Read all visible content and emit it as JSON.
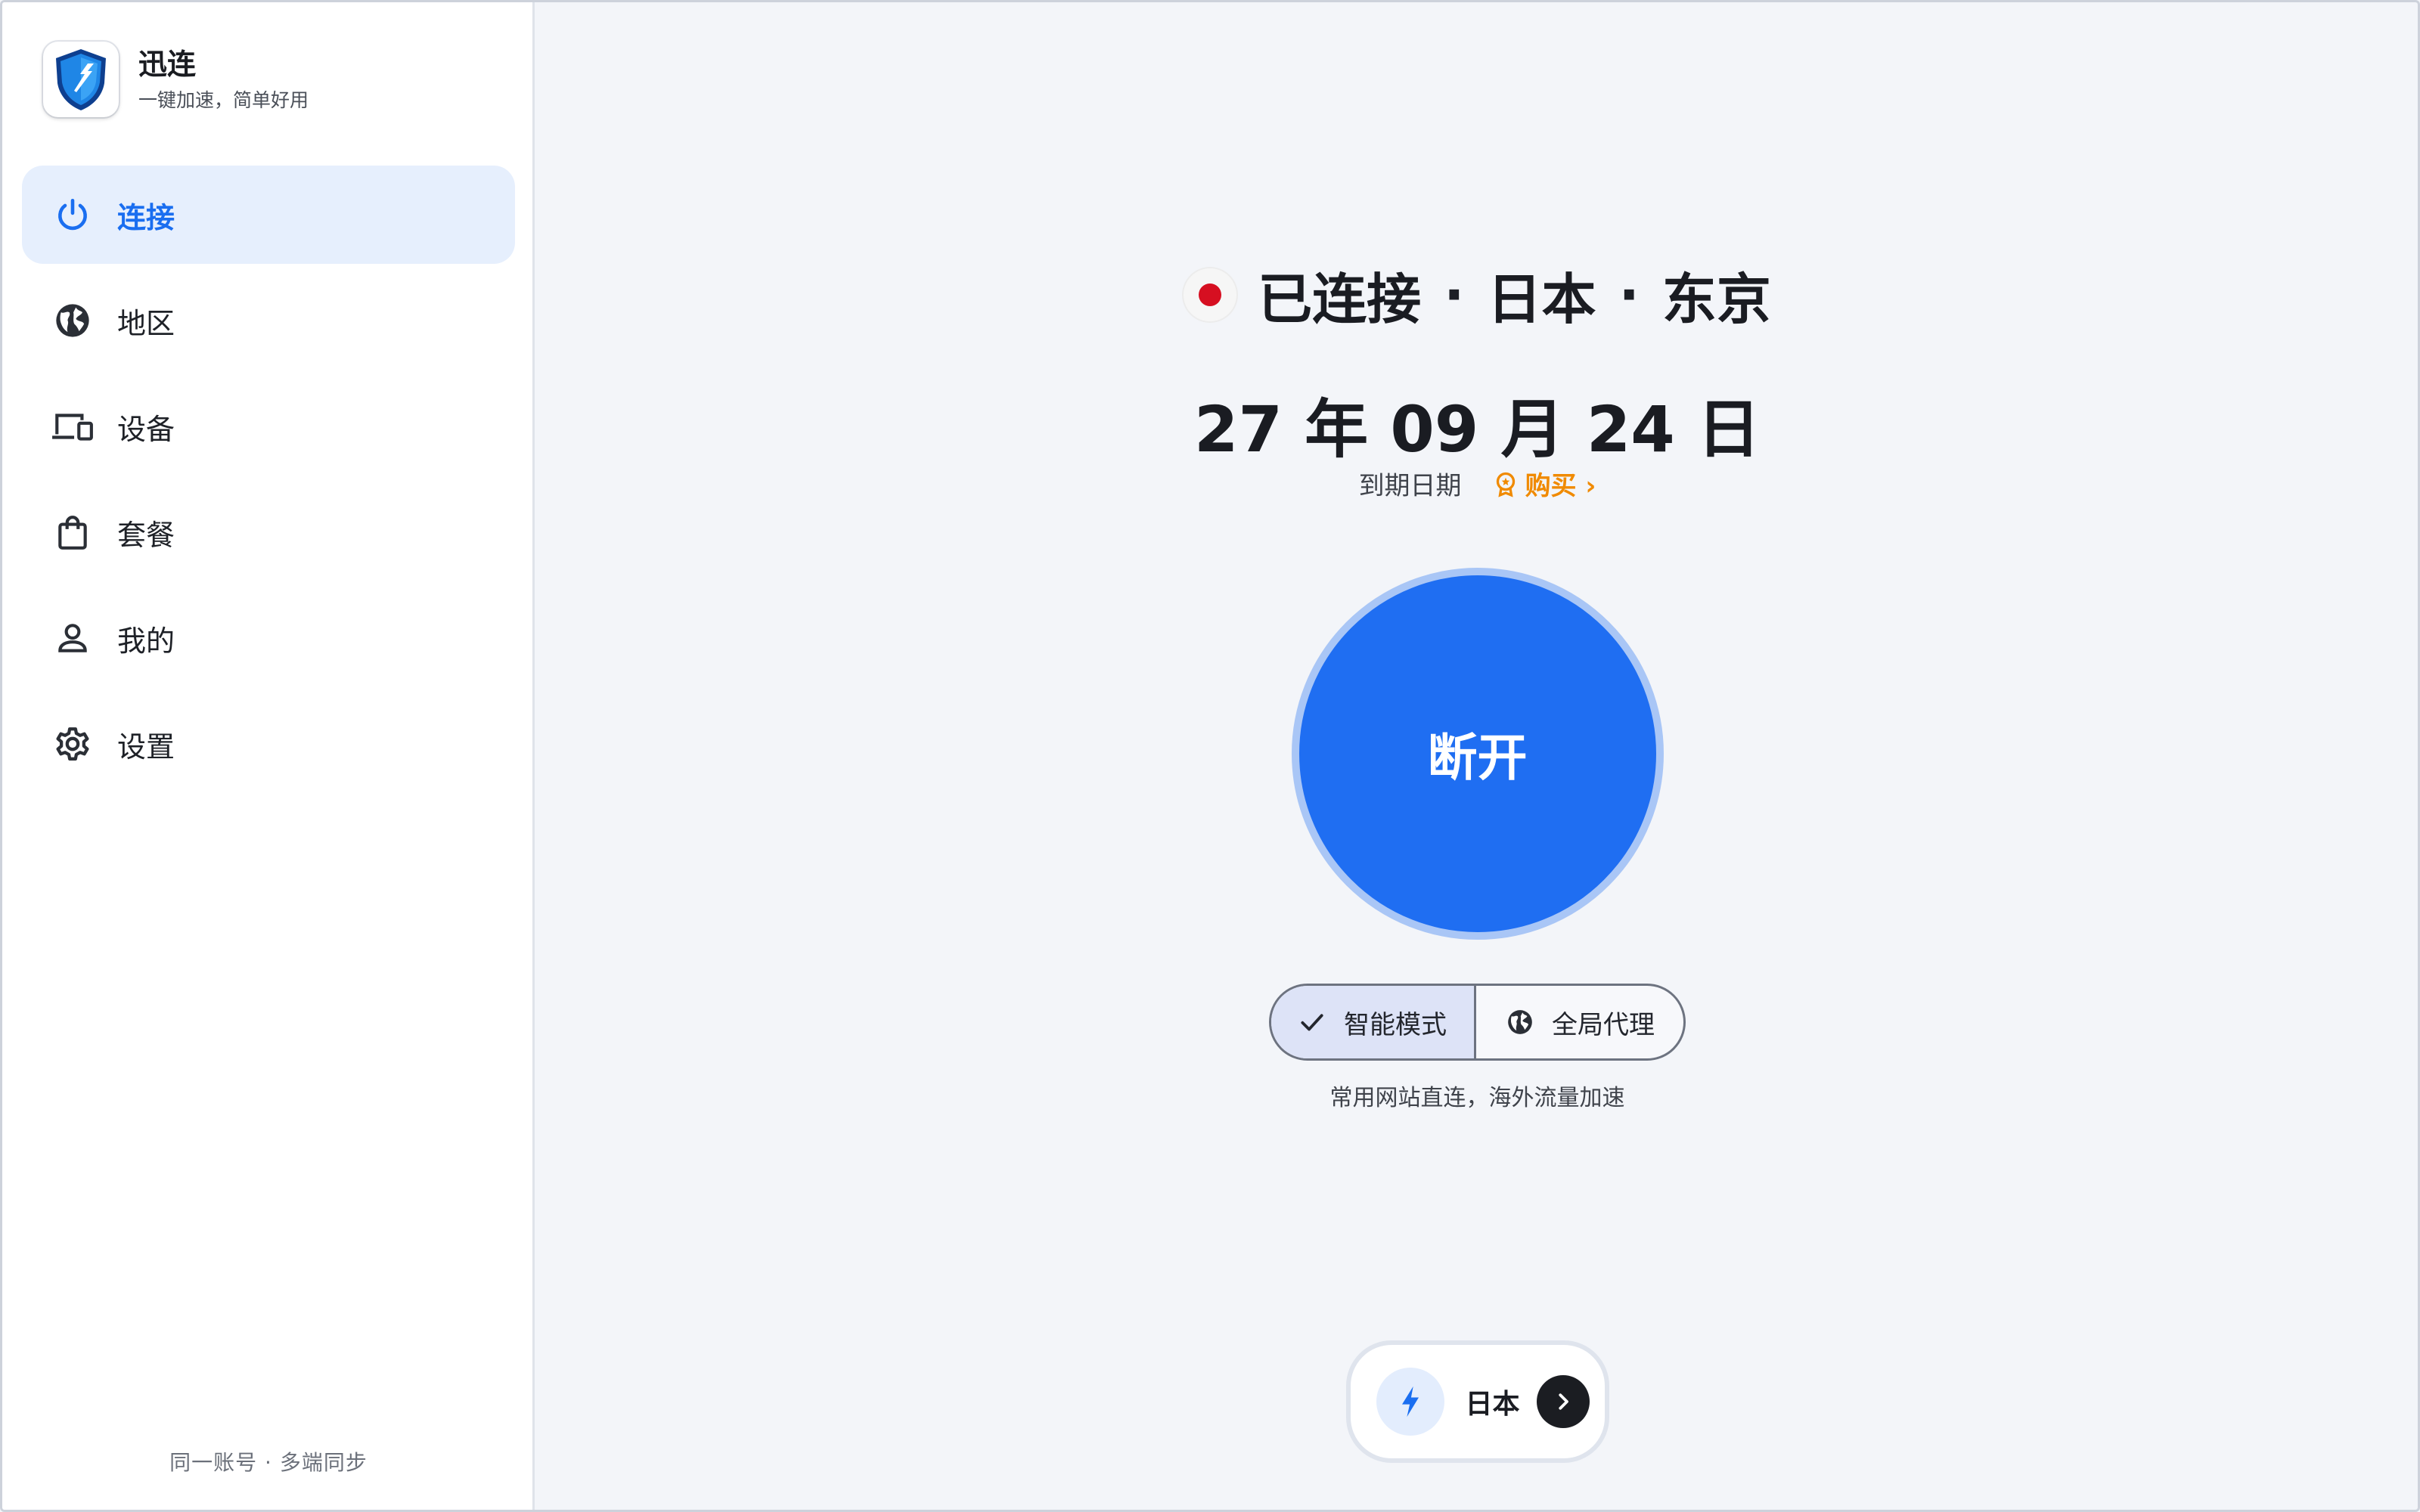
{
  "app": {
    "name": "迅连",
    "tagline": "一键加速，简单好用"
  },
  "sidebar": {
    "items": [
      {
        "label": "连接",
        "icon": "power-icon",
        "active": true
      },
      {
        "label": "地区",
        "icon": "globe-icon",
        "active": false
      },
      {
        "label": "设备",
        "icon": "devices-icon",
        "active": false
      },
      {
        "label": "套餐",
        "icon": "shopping-bag-icon",
        "active": false
      },
      {
        "label": "我的",
        "icon": "person-icon",
        "active": false
      },
      {
        "label": "设置",
        "icon": "gear-icon",
        "active": false
      }
    ],
    "footer": "同一账号 · 多端同步"
  },
  "status": {
    "state": "已连接",
    "country": "日本",
    "city": "东京",
    "separator": "·",
    "flag_color": "#d60f21"
  },
  "expiry": {
    "date": "27 年 09 月 24 日",
    "label": "到期日期",
    "buy_label": "购买 ›"
  },
  "disconnect_button": {
    "label": "断开",
    "color": "#1f6ef2"
  },
  "modes": {
    "items": [
      {
        "label": "智能模式",
        "icon": "check-icon",
        "selected": true
      },
      {
        "label": "全局代理",
        "icon": "globe-icon",
        "selected": false
      }
    ],
    "description": "常用网站直连，海外流量加速"
  },
  "region_selector": {
    "label": "日本",
    "icon": "bolt-icon"
  },
  "colors": {
    "accent": "#1a6ef0",
    "buy": "#f08a00"
  }
}
